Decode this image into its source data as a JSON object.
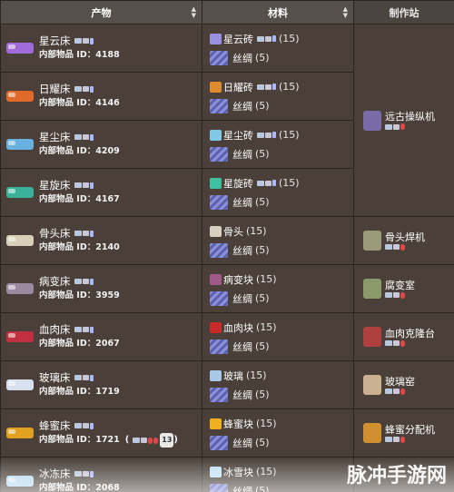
{
  "headers": {
    "product": "产物",
    "materials": "材料",
    "station": "制作站"
  },
  "id_prefix": "内部物品 ID：",
  "silk_name": "丝绸",
  "silk_qty": "(5)",
  "rows": [
    {
      "name": "星云床",
      "id": "4188",
      "color": "#a06ad8",
      "mat": "星云砖",
      "mat_qty": "(15)",
      "mat_color": "#9a8fe0"
    },
    {
      "name": "日耀床",
      "id": "4146",
      "color": "#e06a2a",
      "mat": "日耀砖",
      "mat_qty": "(15)",
      "mat_color": "#e08a30"
    },
    {
      "name": "星尘床",
      "id": "4209",
      "color": "#6ab0e0",
      "mat": "星尘砖",
      "mat_qty": "(15)",
      "mat_color": "#80c8e8"
    },
    {
      "name": "星旋床",
      "id": "4167",
      "color": "#3ab09a",
      "mat": "星旋砖",
      "mat_qty": "(15)",
      "mat_color": "#40c0a0"
    },
    {
      "name": "骨头床",
      "id": "2140",
      "color": "#d8d0b8",
      "mat": "骨头",
      "mat_qty": "(15)",
      "mat_color": "#d8d0c0"
    },
    {
      "name": "病变床",
      "id": "3959",
      "color": "#9a8aa0",
      "mat": "病变块",
      "mat_qty": "(15)",
      "mat_color": "#a05a8a"
    },
    {
      "name": "血肉床",
      "id": "2067",
      "color": "#c03040",
      "mat": "血肉块",
      "mat_qty": "(15)",
      "mat_color": "#c82a2a"
    },
    {
      "name": "玻璃床",
      "id": "1719",
      "color": "#d8e0f0",
      "mat": "玻璃",
      "mat_qty": "(15)",
      "mat_color": "#a8c8e8"
    },
    {
      "name": "蜂蜜床",
      "id": "1721",
      "color": "#e0a020",
      "mat": "蜂蜜块",
      "mat_qty": "(15)",
      "mat_color": "#f0b020",
      "extra_badge": "13"
    },
    {
      "name": "冰冻床",
      "id": "2068",
      "color": "#b8d8f0",
      "mat": "冰雪块",
      "mat_qty": "(15)",
      "mat_color": "#c0e0f8"
    }
  ],
  "stations": [
    {
      "name_line1": "远古操纵机",
      "color": "#7a6aa8"
    },
    {
      "name_line1": "骨头焊机",
      "color": "#9a9a7a"
    },
    {
      "name_line1": "腐变室",
      "color": "#8a9a6a"
    },
    {
      "name_line1": "血肉克隆台",
      "color": "#b04040"
    },
    {
      "name_line1": "玻璃窑",
      "color": "#c8b090"
    },
    {
      "name_line1": "蜂蜜分配机",
      "color": "#d09030"
    }
  ],
  "watermark": "脉冲手游网"
}
